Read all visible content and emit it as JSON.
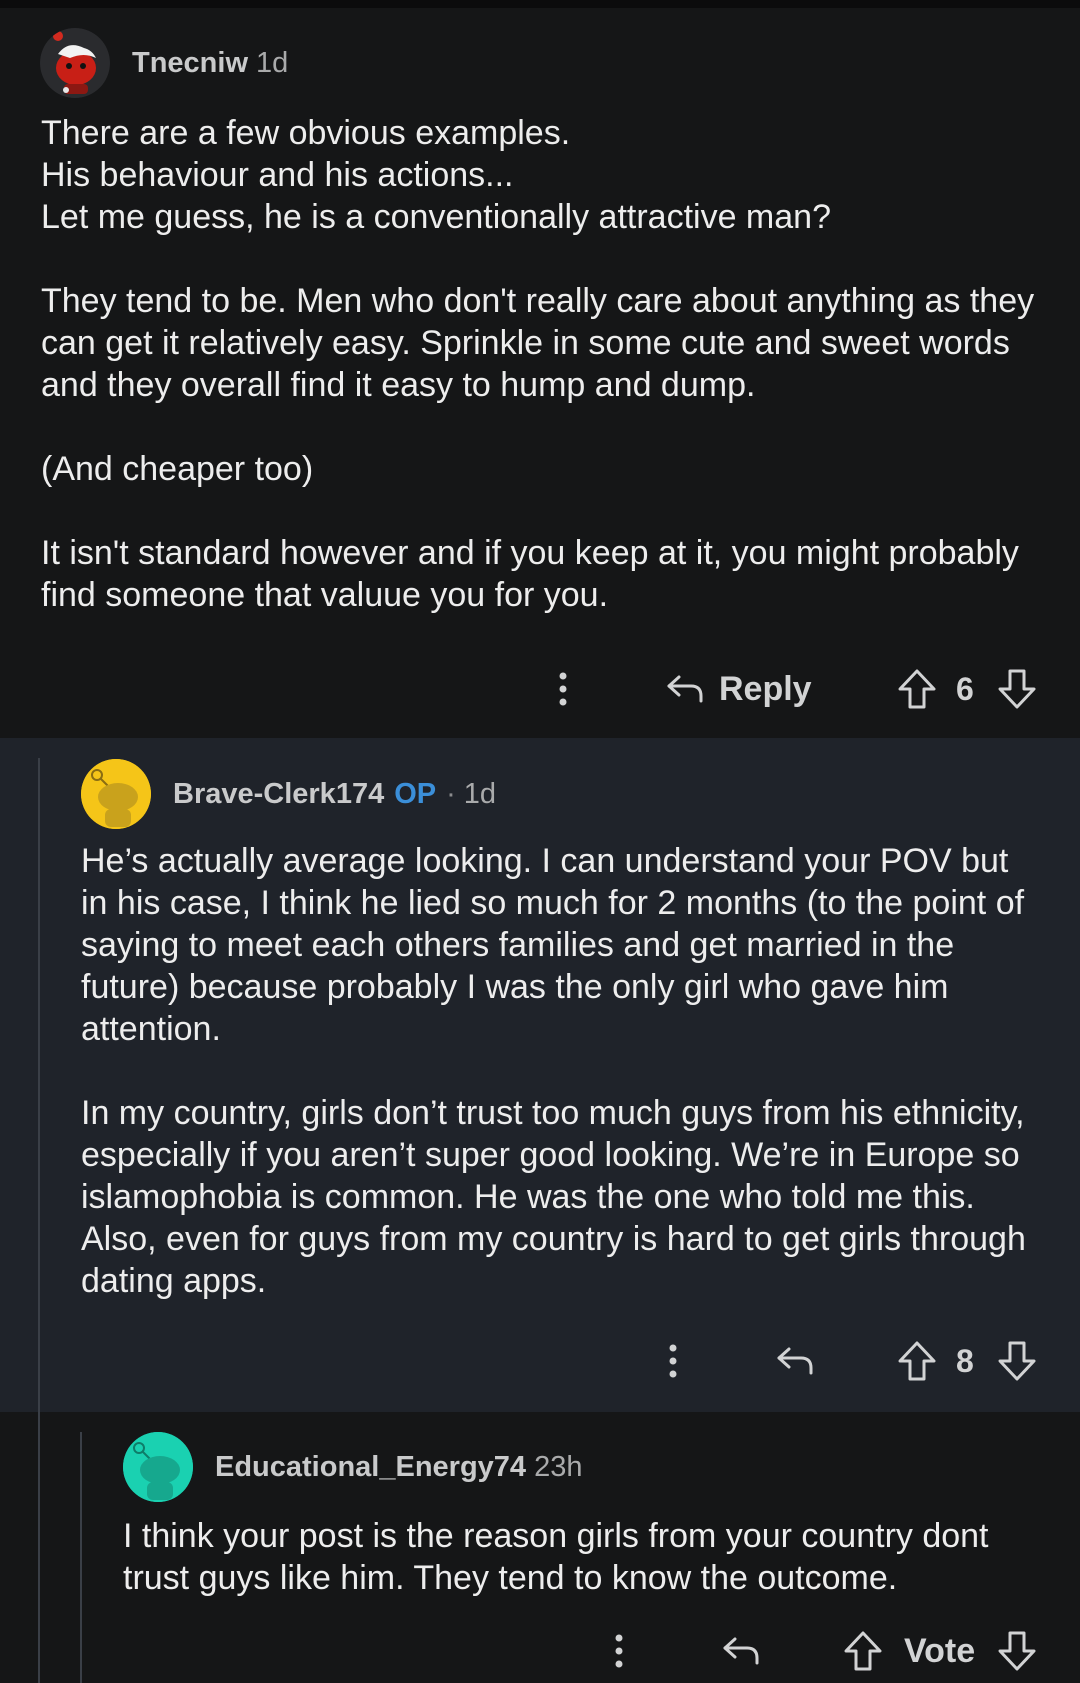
{
  "comments": [
    {
      "username": "Tnecniw",
      "time": "1d",
      "body": "There are a few obvious examples.\nHis behaviour and his actions...\nLet me guess, he is a conventionally attractive man?\n\nThey tend to be. Men who don't really care about anything as they can get it relatively easy. Sprinkle in some cute and sweet words and they overall find it easy to hump and dump.\n\n(And cheaper too)\n\nIt isn't standard however and if you keep at it, you might probably find someone that valuue you for you.",
      "reply_label": "Reply",
      "score": "6"
    },
    {
      "username": "Brave-Clerk174",
      "op_tag": "OP",
      "separator": "·",
      "time": "1d",
      "body": "He’s actually average looking. I can understand your POV but in his case, I think he lied so much for 2 months (to the point of saying to meet each others families and get married in the future) because probably I was the only girl who gave him attention.\n\nIn my country, girls don’t trust too much guys from his ethnicity, especially if you aren’t super good looking. We’re in Europe so islamophobia is common. He was the one who told me this. Also, even for guys from my country is hard to get girls through dating apps.",
      "score": "8"
    },
    {
      "username": "Educational_Energy74",
      "time": "23h",
      "body": "I think your post is the reason girls from your country dont trust guys like him. They tend to know the outcome.",
      "score": "Vote"
    }
  ],
  "colors": {
    "op_blue": "#3b8fd9",
    "reply_bg": "#1f232a",
    "avatar_yellow": "#f5c518",
    "avatar_teal": "#1ad1b1",
    "avatar_red": "#d22a1f"
  },
  "icons": [
    "more-options-icon",
    "reply-arrow-icon",
    "upvote-arrow-icon",
    "downvote-arrow-icon",
    "snoo-avatar-icon"
  ]
}
